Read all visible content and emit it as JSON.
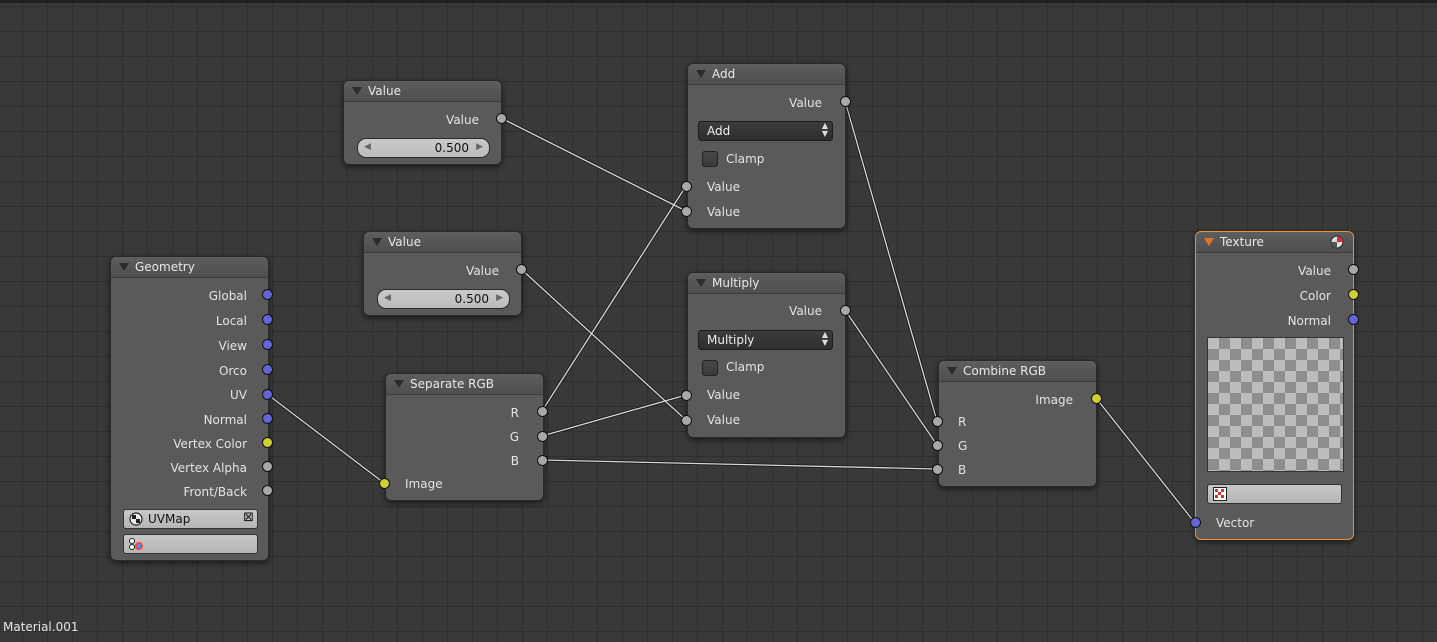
{
  "material_name": "Material.001",
  "nodes": {
    "value1": {
      "title": "Value",
      "output": "Value",
      "field": "0.500"
    },
    "value2": {
      "title": "Value",
      "output": "Value",
      "field": "0.500"
    },
    "add": {
      "title": "Add",
      "output": "Value",
      "operation": "Add",
      "clamp_label": "Clamp",
      "input1": "Value",
      "input2": "Value"
    },
    "multiply": {
      "title": "Multiply",
      "output": "Value",
      "operation": "Multiply",
      "clamp_label": "Clamp",
      "input1": "Value",
      "input2": "Value"
    },
    "geometry": {
      "title": "Geometry",
      "outputs": [
        "Global",
        "Local",
        "View",
        "Orco",
        "UV",
        "Normal",
        "Vertex Color",
        "Vertex Alpha",
        "Front/Back"
      ],
      "uv_map": "UVMap",
      "vertex_color": ""
    },
    "separate_rgb": {
      "title": "Separate RGB",
      "outputs": [
        "R",
        "G",
        "B"
      ],
      "input": "Image"
    },
    "combine_rgb": {
      "title": "Combine RGB",
      "output": "Image",
      "inputs": [
        "R",
        "G",
        "B"
      ]
    },
    "texture": {
      "title": "Texture",
      "outputs": [
        "Value",
        "Color",
        "Normal"
      ],
      "texture_name": "",
      "input": "Vector"
    }
  },
  "colors": {
    "socket_value": "#a8a8a8",
    "socket_vector": "#6464d6",
    "socket_color": "#cfcf33",
    "active_outline": "#e0973a",
    "link": "#d8d8d8"
  }
}
